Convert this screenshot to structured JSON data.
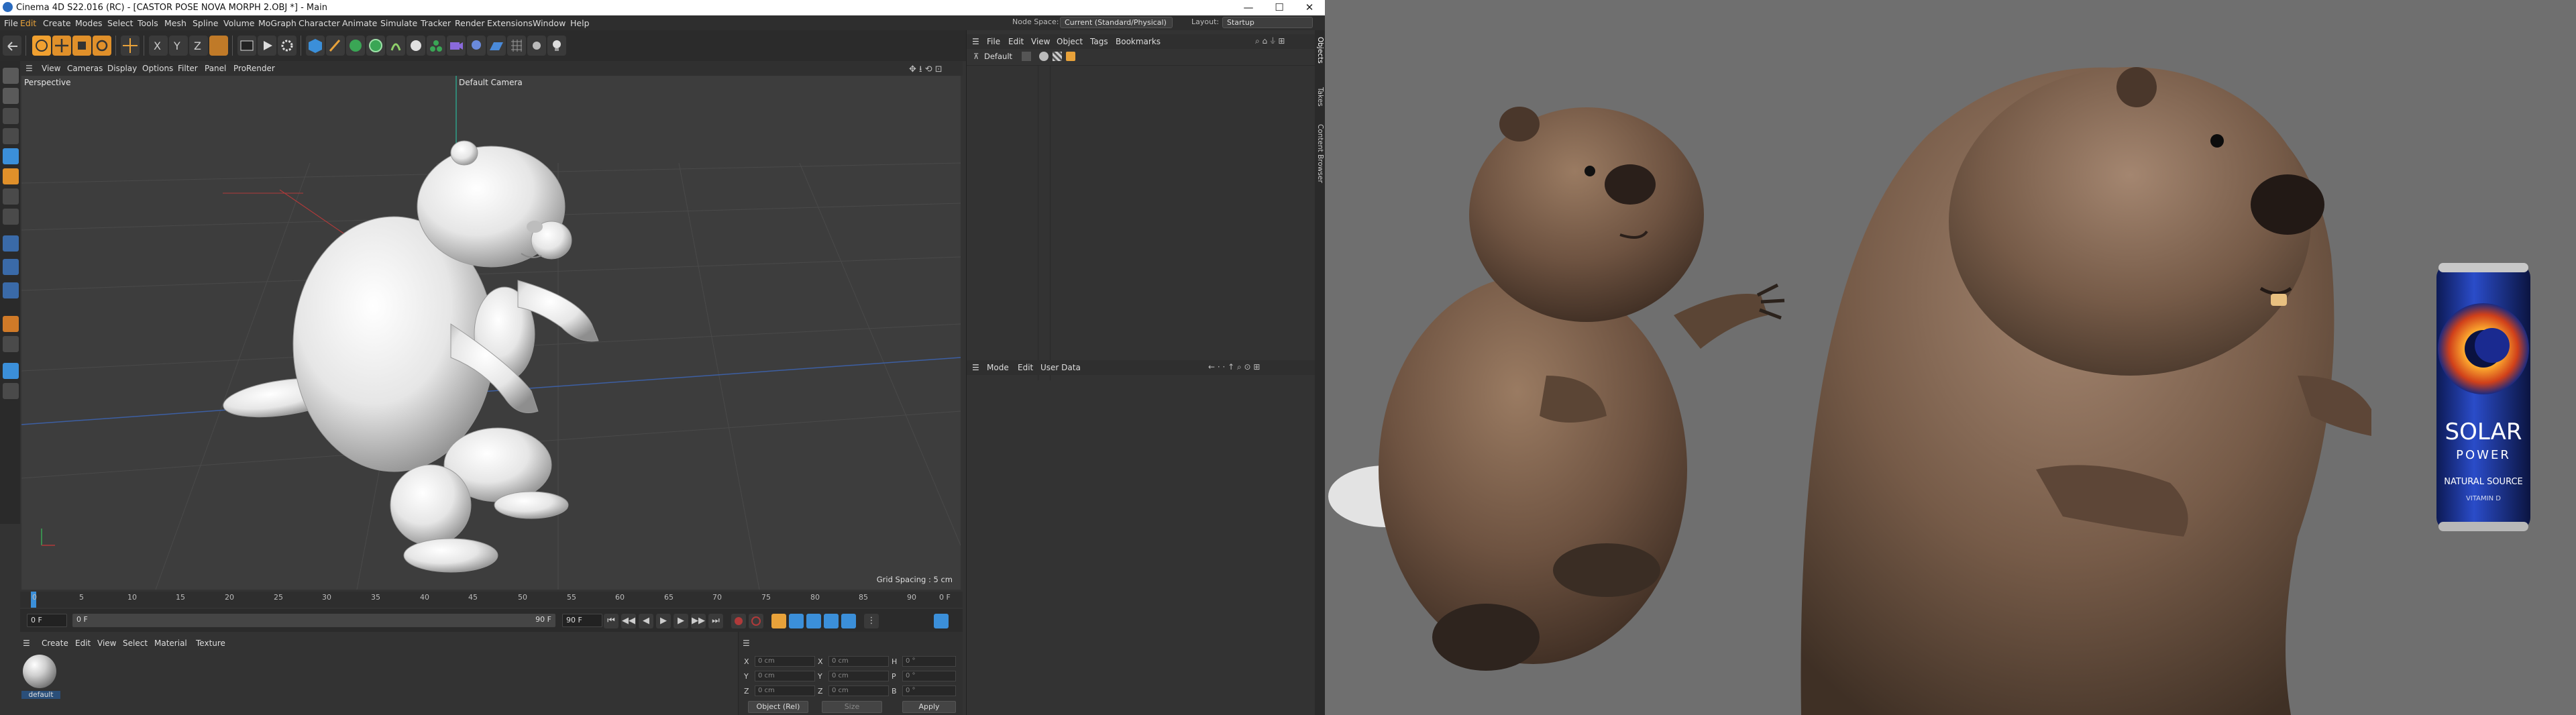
{
  "window": {
    "title": "Cinema 4D S22.016 (RC) - [CASTOR POSE NOVA MORPH 2.OBJ *] - Main",
    "controls": [
      "—",
      "☐",
      "✕"
    ]
  },
  "menubar": {
    "items": [
      "File",
      "Edit",
      "Create",
      "Modes",
      "Select",
      "Tools",
      "Mesh",
      "Spline",
      "Volume",
      "MoGraph",
      "Character",
      "Animate",
      "Simulate",
      "Tracker",
      "Render",
      "Extensions",
      "Window",
      "Help"
    ],
    "node_space_label": "Node Space:",
    "node_space_value": "Current (Standard/Physical)",
    "layout_label": "Layout:",
    "layout_value": "Startup"
  },
  "viewport": {
    "menu": [
      "View",
      "Cameras",
      "Display",
      "Options",
      "Filter",
      "Panel",
      "ProRender"
    ],
    "label": "Perspective",
    "camera": "Default Camera",
    "grid_spacing": "Grid Spacing : 5 cm"
  },
  "timeline": {
    "ticks": [
      "0",
      "5",
      "10",
      "15",
      "20",
      "25",
      "30",
      "35",
      "40",
      "45",
      "50",
      "55",
      "60",
      "65",
      "70",
      "75",
      "80",
      "85",
      "90"
    ],
    "end_frame": "0 F"
  },
  "playbar": {
    "current": "0 F",
    "start": "0 F",
    "end": "90 F",
    "max": "90 F"
  },
  "material_manager": {
    "menu": [
      "Create",
      "Edit",
      "View",
      "Select",
      "Material",
      "Texture"
    ],
    "material_name": "default"
  },
  "coordinates": {
    "rows": [
      {
        "a": "X",
        "av": "0 cm",
        "b": "X",
        "bv": "0 cm",
        "c": "H",
        "cv": "0 °"
      },
      {
        "a": "Y",
        "av": "0 cm",
        "b": "Y",
        "bv": "0 cm",
        "c": "P",
        "cv": "0 °"
      },
      {
        "a": "Z",
        "av": "0 cm",
        "b": "Z",
        "bv": "0 cm",
        "c": "B",
        "cv": "0 °"
      }
    ],
    "mode": "Object (Rel)",
    "size": "Size",
    "apply": "Apply"
  },
  "objects_panel": {
    "menu": [
      "File",
      "Edit",
      "View",
      "Object",
      "Tags",
      "Bookmarks"
    ],
    "layer": "Default"
  },
  "attributes_panel": {
    "menu": [
      "Mode",
      "Edit",
      "User Data"
    ]
  },
  "side_tabs": [
    "Objects",
    "Takes",
    "Content Browser"
  ],
  "render_can": {
    "brand_line1": "SOLAR",
    "brand_line2": "POWER",
    "tagline": "NATURAL SOURCE",
    "sub": "VITAMIN D"
  },
  "colors": {
    "accent": "#e8a23a",
    "ui_bg": "#333333",
    "render_bg": "#6f6f6f"
  }
}
